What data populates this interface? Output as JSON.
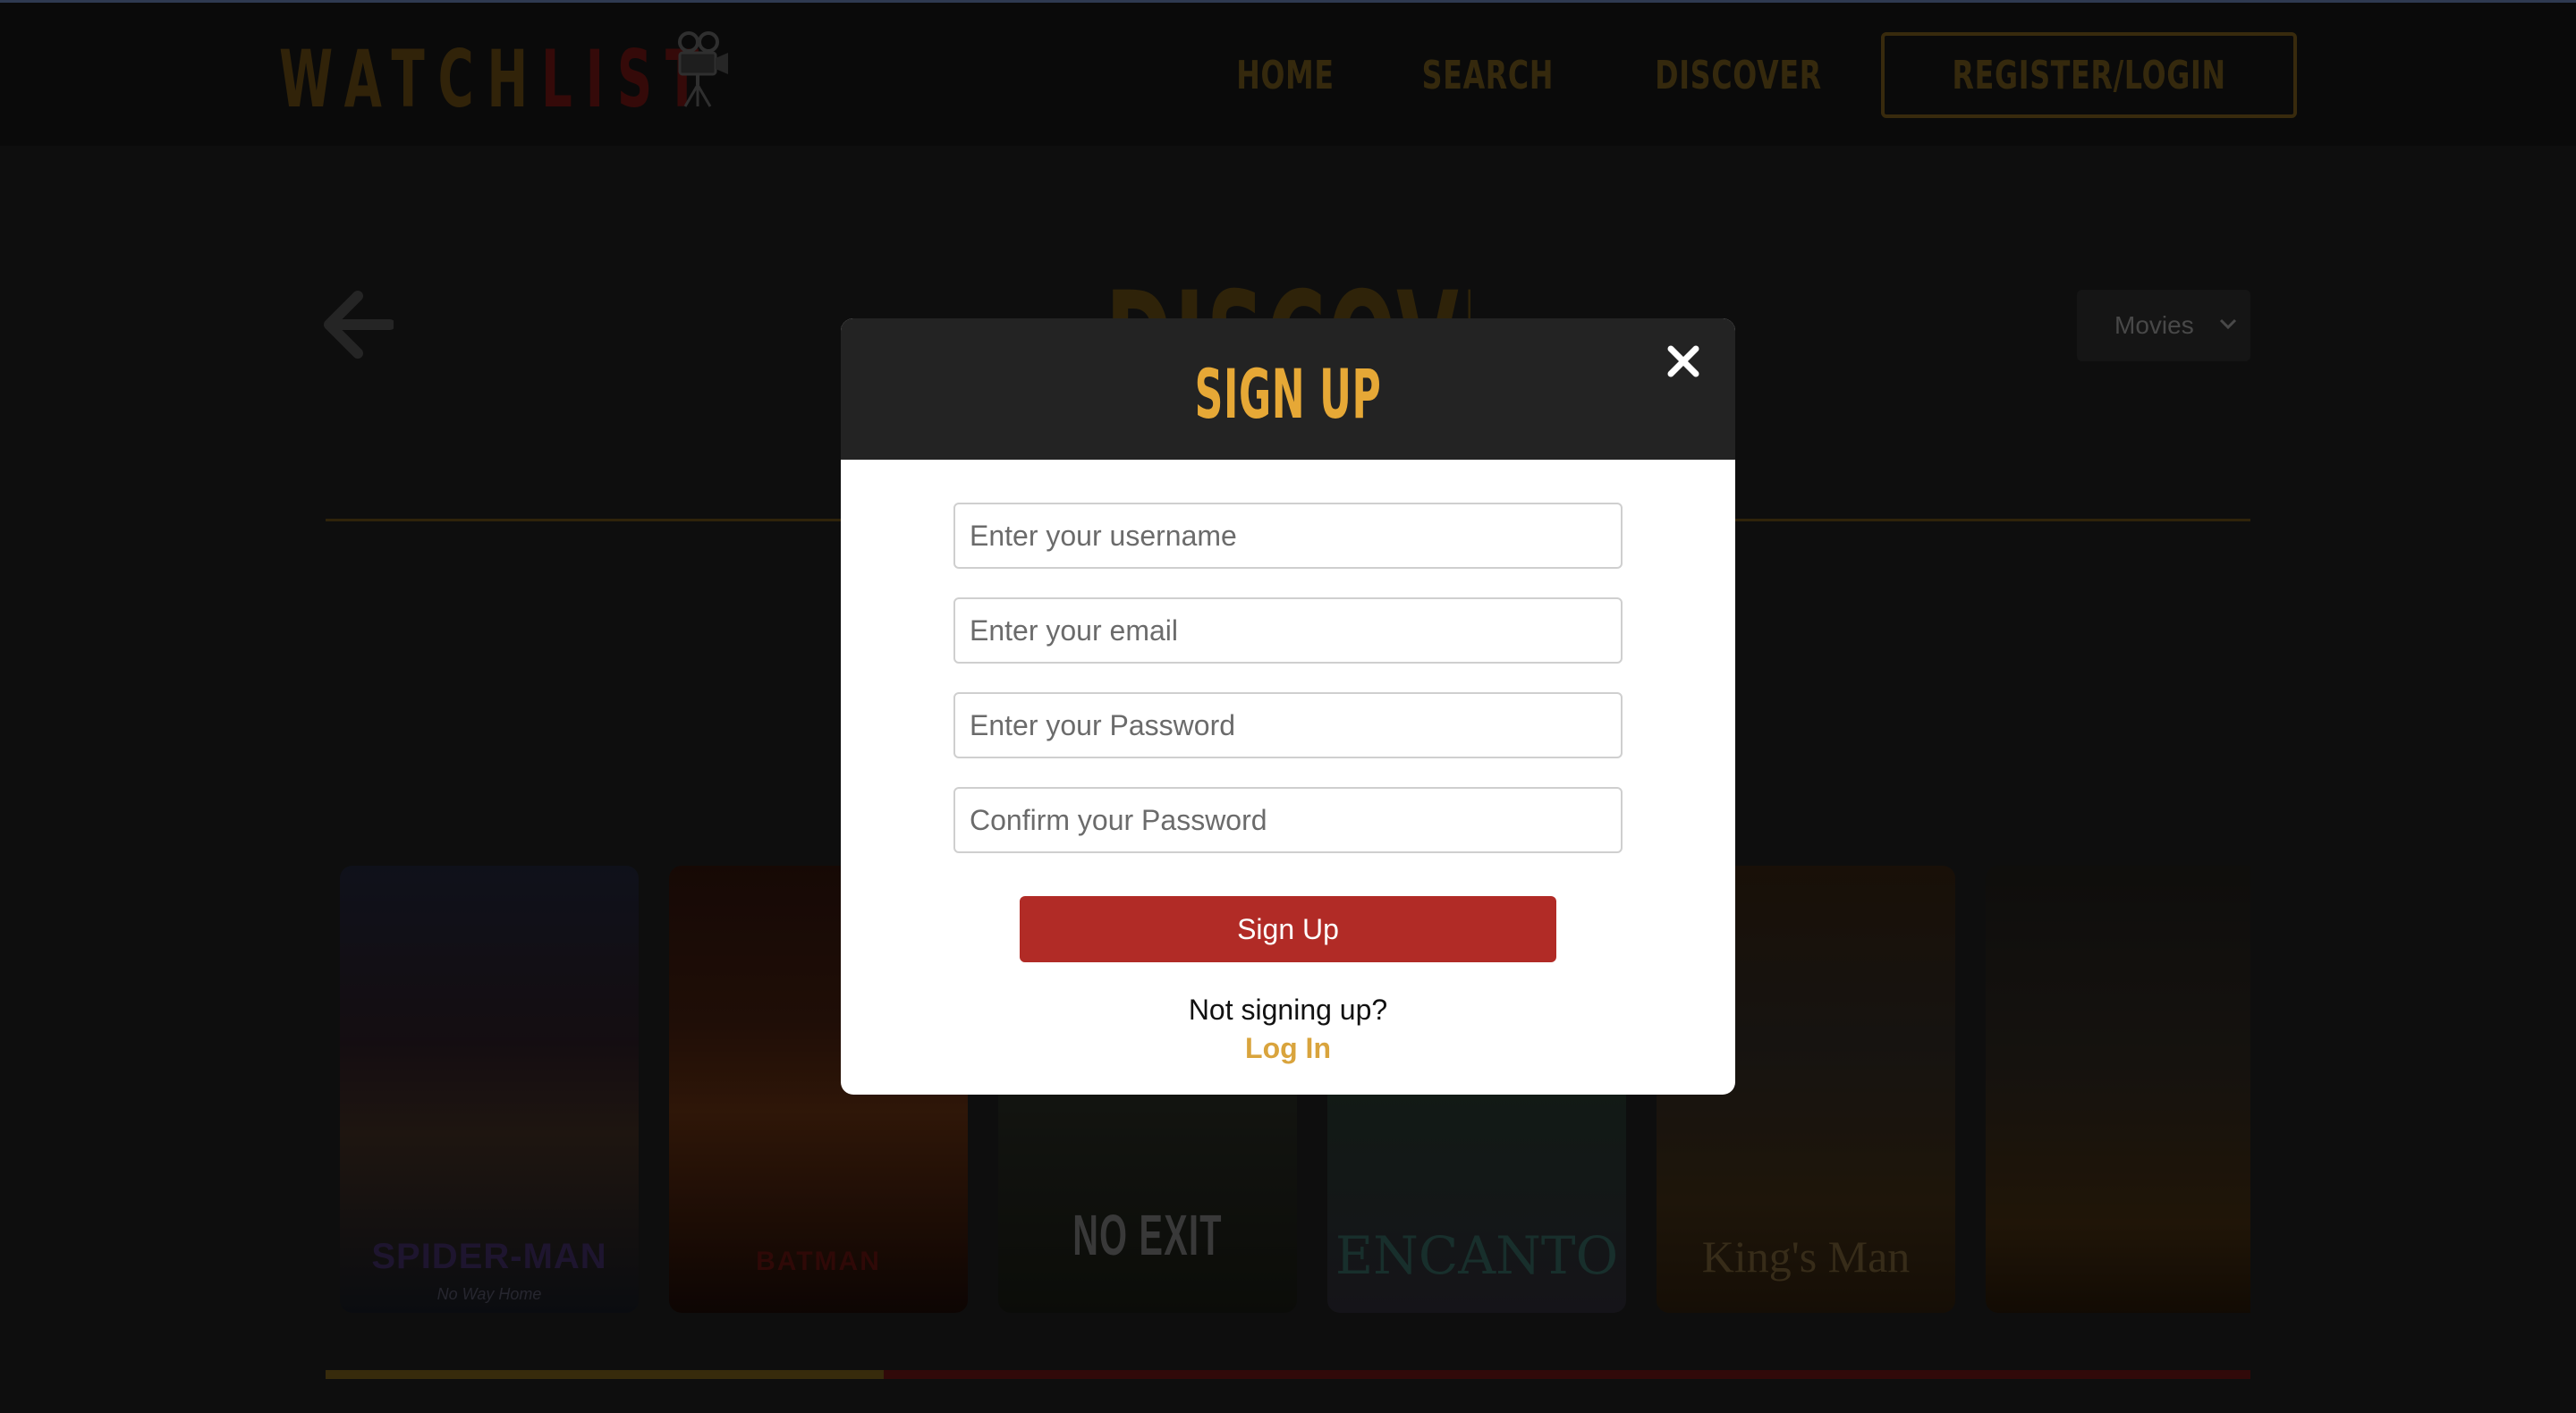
{
  "brand": {
    "logo_part1": "WATCH",
    "logo_part2": "LIST",
    "camera_icon": "movie-camera-icon"
  },
  "nav": {
    "home": "HOME",
    "search": "SEARCH",
    "discover": "DISCOVER",
    "register_login": "REGISTER/LOGIN"
  },
  "discover": {
    "heading": "DISCOVER",
    "type_select": {
      "selected": "Movies"
    },
    "back_icon": "arrow-left-icon"
  },
  "posters": [
    {
      "title": "SPIDER-MAN",
      "subtitle": "No Way Home"
    },
    {
      "title": "BATMAN"
    },
    {
      "title": "NO EXIT"
    },
    {
      "title": "ENCANTO"
    },
    {
      "title": "King's Man"
    },
    {
      "title": ""
    }
  ],
  "scroll_progress": 0.29,
  "modal": {
    "title": "SIGN UP",
    "username_placeholder": "Enter your username",
    "email_placeholder": "Enter your email",
    "password_placeholder": "Enter your Password",
    "confirm_placeholder": "Confirm your Password",
    "submit_label": "Sign Up",
    "alt_prompt": "Not signing up?",
    "alt_link": "Log In",
    "close_icon": "close-icon"
  },
  "colors": {
    "accent_gold": "#e6a836",
    "accent_red": "#b12b26",
    "modal_header": "#232323"
  }
}
